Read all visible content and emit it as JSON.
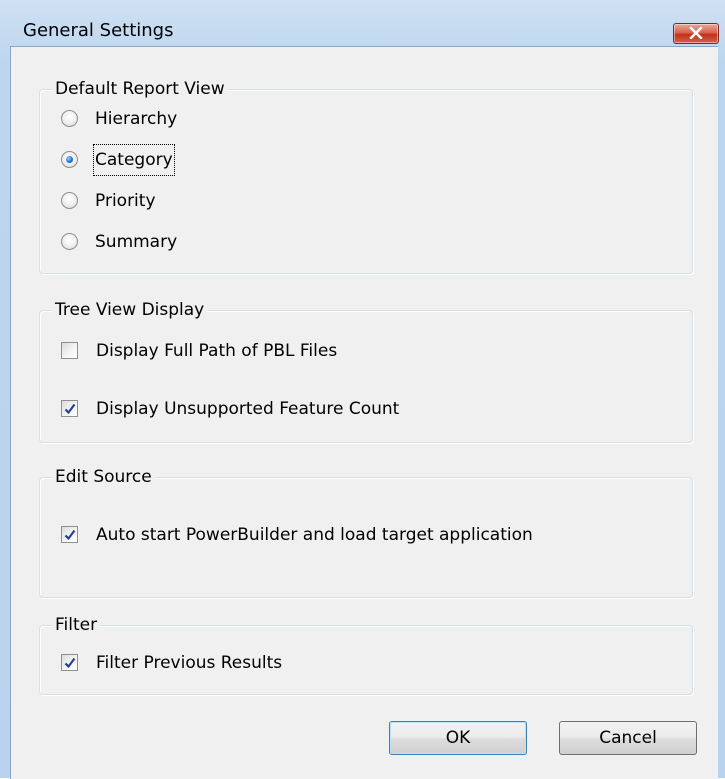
{
  "window": {
    "title": "General Settings"
  },
  "default_report_view": {
    "label": "Default Report View",
    "options": [
      {
        "label": "Hierarchy",
        "selected": false
      },
      {
        "label": "Category",
        "selected": true
      },
      {
        "label": "Priority",
        "selected": false
      },
      {
        "label": "Summary",
        "selected": false
      }
    ]
  },
  "tree_view_display": {
    "label": "Tree View Display",
    "options": [
      {
        "label": "Display Full Path of PBL Files",
        "checked": false
      },
      {
        "label": "Display Unsupported Feature Count",
        "checked": true
      }
    ]
  },
  "edit_source": {
    "label": "Edit Source",
    "options": [
      {
        "label": "Auto start PowerBuilder and load target application",
        "checked": true
      }
    ]
  },
  "filter": {
    "label": "Filter",
    "options": [
      {
        "label": "Filter Previous Results",
        "checked": true
      }
    ]
  },
  "buttons": {
    "ok": "OK",
    "cancel": "Cancel"
  },
  "colors": {
    "accent": "#1f74d4",
    "close_button": "#c2321c",
    "dialog_background": "#f0f0f0"
  }
}
